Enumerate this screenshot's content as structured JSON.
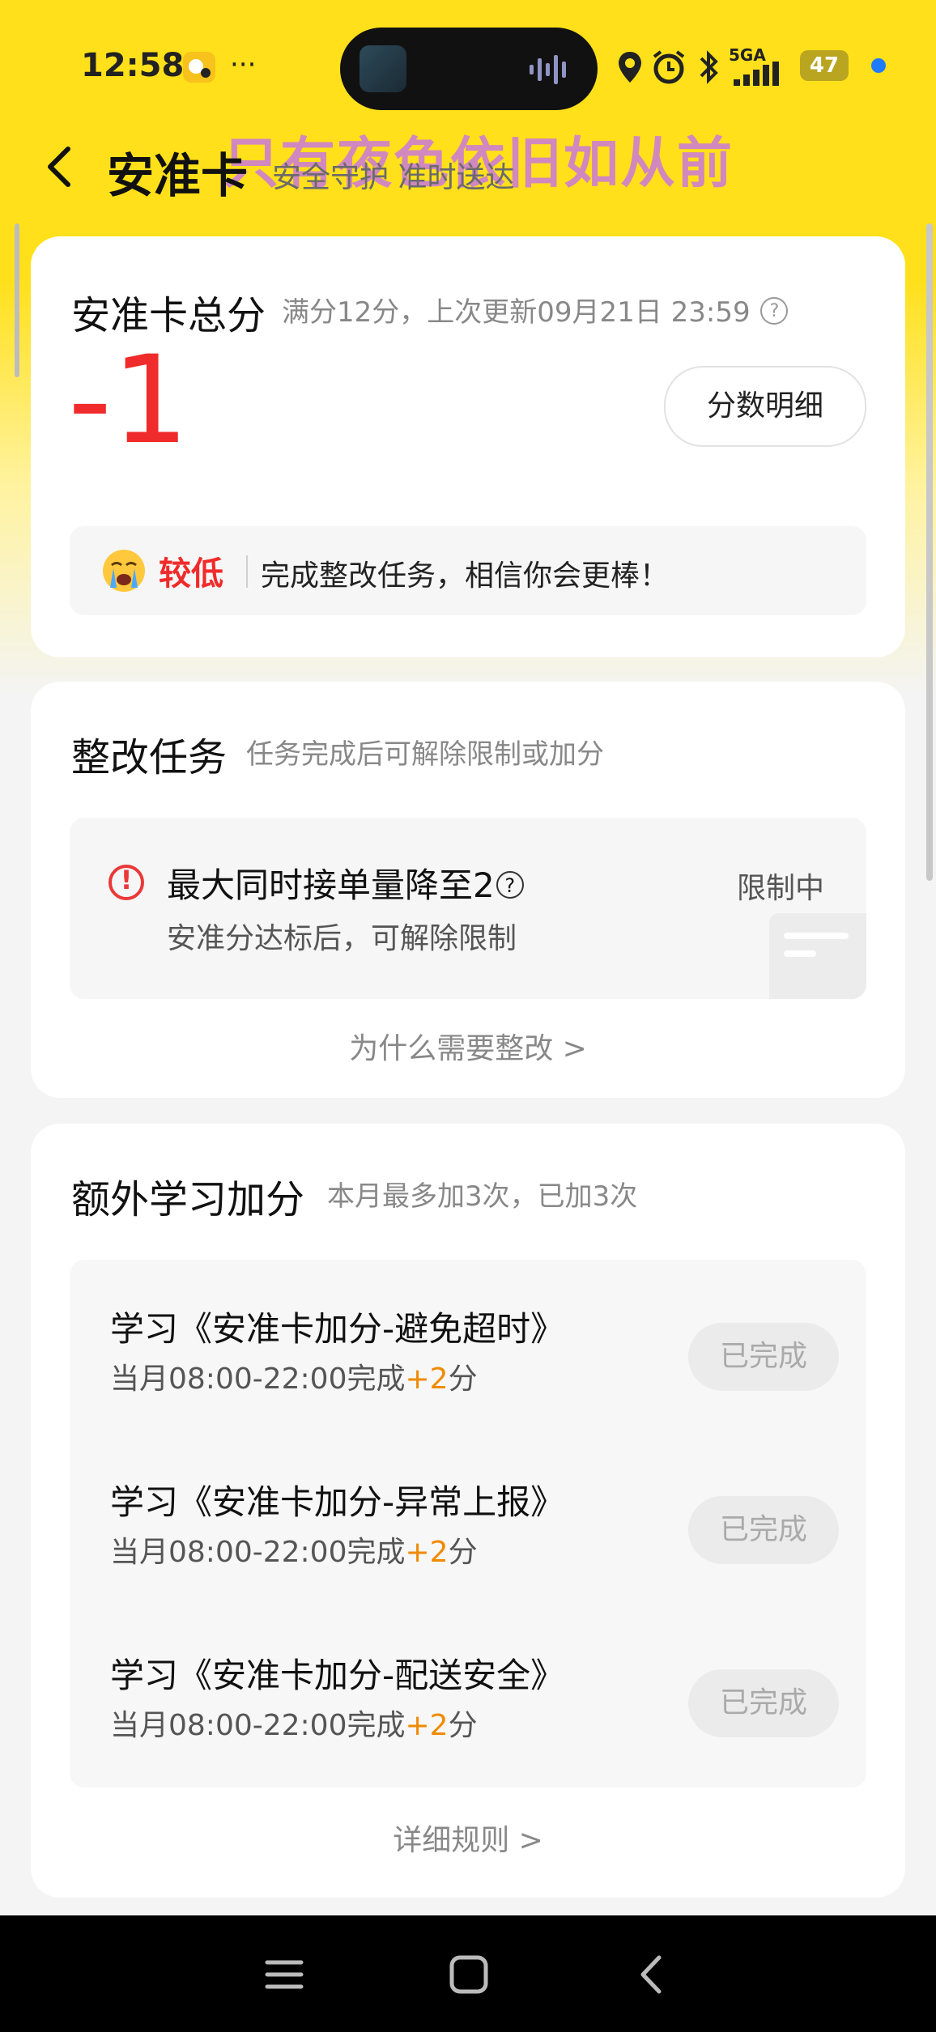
{
  "status_bar": {
    "time": "12:58",
    "network": "5GA",
    "battery": "47",
    "icons": [
      "notification-app-icon",
      "more-dots-icon",
      "location-icon",
      "alarm-icon",
      "bluetooth-icon",
      "signal-icon",
      "battery-icon"
    ]
  },
  "overlay_text": "只有夜色依旧如从前",
  "header": {
    "title": "安准卡",
    "subtitle": "安全守护 准时送达"
  },
  "score_card": {
    "title": "安准卡总分",
    "meta": "满分12分，上次更新09月21日 23:59",
    "score": "-1",
    "detail_button": "分数明细",
    "level": "较低",
    "tip": "完成整改任务，相信你会更棒！"
  },
  "rectify_card": {
    "title": "整改任务",
    "subtitle": "任务完成后可解除限制或加分",
    "task_title": "最大同时接单量降至2",
    "task_desc": "安准分达标后，可解除限制",
    "task_status": "限制中",
    "link": "为什么需要整改 >"
  },
  "study_card": {
    "title": "额外学习加分",
    "subtitle": "本月最多加3次，已加3次",
    "items": [
      {
        "title": "学习《安准卡加分-避免超时》",
        "desc_prefix": "当月08:00-22:00完成",
        "plus": "+2",
        "desc_suffix": "分",
        "button": "已完成"
      },
      {
        "title": "学习《安准卡加分-异常上报》",
        "desc_prefix": "当月08:00-22:00完成",
        "plus": "+2",
        "desc_suffix": "分",
        "button": "已完成"
      },
      {
        "title": "学习《安准卡加分-配送安全》",
        "desc_prefix": "当月08:00-22:00完成",
        "plus": "+2",
        "desc_suffix": "分",
        "button": "已完成"
      }
    ],
    "link": "详细规则 >"
  },
  "colors": {
    "brand_yellow": "#ffe01a",
    "score_red": "#f02b2b",
    "plus_orange": "#f08a00"
  }
}
